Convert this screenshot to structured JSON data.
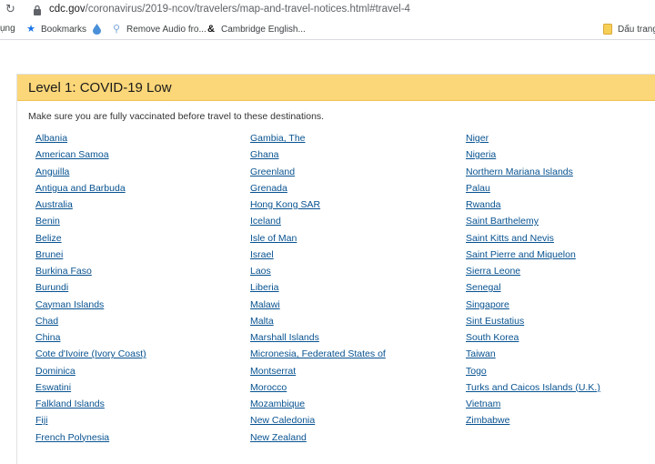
{
  "browser": {
    "url_host": "cdc.gov",
    "url_path": "/coronavirus/2019-ncov/travelers/map-and-travel-notices.html#travel-4"
  },
  "bookmarks_bar": {
    "items": [
      {
        "label": "ụng"
      },
      {
        "label": "Bookmarks"
      },
      {
        "label": "Remove Audio fro..."
      },
      {
        "label": "Cambridge English..."
      },
      {
        "label": "Dấu trang"
      }
    ]
  },
  "panel": {
    "title": "Level 1: COVID-19 Low",
    "intro": "Make sure you are fully vaccinated before travel to these destinations.",
    "header_color": "#fbd779",
    "link_color": "#075290"
  },
  "destinations": {
    "col1": [
      "Albania",
      "American Samoa",
      "Anguilla",
      "Antigua and Barbuda",
      "Australia",
      "Benin",
      "Belize",
      "Brunei",
      "Burkina Faso",
      "Burundi",
      "Cayman Islands",
      "Chad",
      "China",
      "Cote d'Ivoire (Ivory Coast)",
      "Dominica",
      "Eswatini",
      "Falkland Islands",
      "Fiji",
      "French Polynesia"
    ],
    "col2": [
      "Gambia, The",
      "Ghana",
      "Greenland",
      "Grenada",
      "Hong Kong SAR",
      "Iceland",
      "Isle of Man",
      "Israel",
      "Laos",
      "Liberia",
      "Malawi",
      "Malta",
      "Marshall Islands",
      "Micronesia, Federated States of",
      "Montserrat",
      "Morocco",
      "Mozambique",
      "New Caledonia",
      "New Zealand"
    ],
    "col3": [
      "Niger",
      "Nigeria",
      "Northern Mariana Islands",
      "Palau",
      "Rwanda",
      "Saint Barthelemy",
      "Saint Kitts and Nevis",
      "Saint Pierre and Miquelon",
      "Sierra Leone",
      "Senegal",
      "Singapore",
      "Sint Eustatius",
      "South Korea",
      "Taiwan",
      "Togo",
      "Turks and Caicos Islands (U.K.)",
      "Vietnam",
      "Zimbabwe"
    ]
  }
}
